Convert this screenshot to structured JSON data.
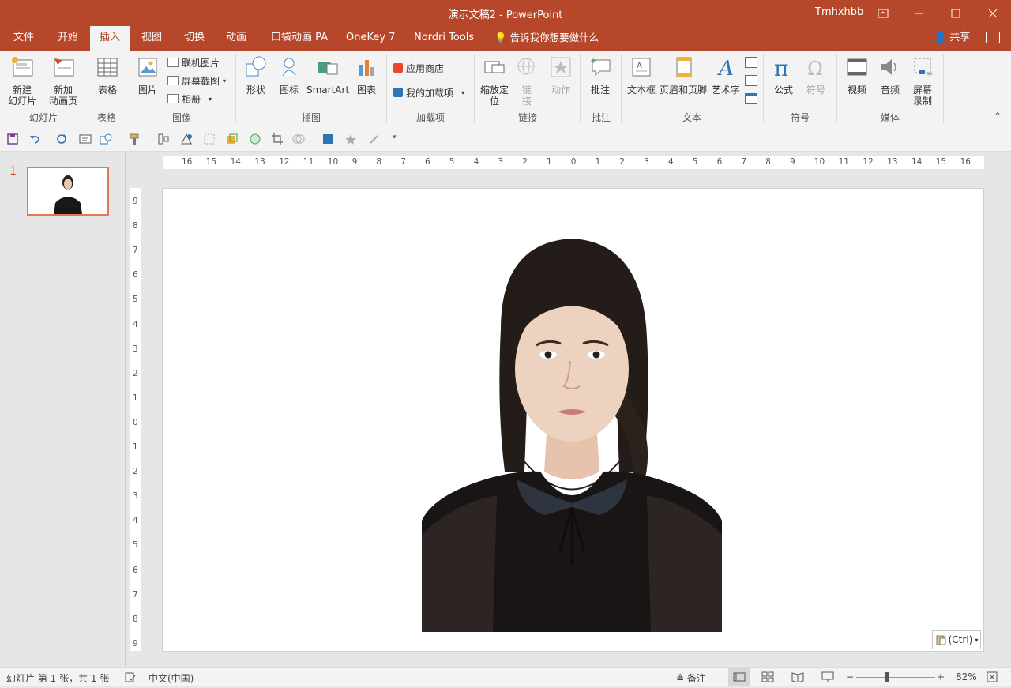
{
  "titlebar": {
    "doc_title": "演示文稿2  -  PowerPoint",
    "user": "Tmhxhbb"
  },
  "menu": {
    "tabs": [
      "文件",
      "开始",
      "插入",
      "视图",
      "切换",
      "动画",
      "口袋动画 PA",
      "OneKey 7",
      "Nordri Tools"
    ],
    "active_tab": "插入",
    "tell_me": "告诉我你想要做什么",
    "share": "共享"
  },
  "ribbon": {
    "slides": {
      "new_slide_l1": "新建",
      "new_slide_l2": "幻灯片",
      "new_anim_l1": "新加",
      "new_anim_l2": "动画页",
      "group": "幻灯片"
    },
    "table": {
      "label": "表格",
      "group": "表格"
    },
    "images": {
      "picture": "图片",
      "online": "联机图片",
      "screenshot": "屏幕截图",
      "album": "相册",
      "group": "图像"
    },
    "illustrations": {
      "shapes": "形状",
      "icons": "图标",
      "smartart": "SmartArt",
      "chart": "图表",
      "group": "插图"
    },
    "addins": {
      "store": "应用商店",
      "my_addins": "我的加载项",
      "group": "加载项"
    },
    "links": {
      "zoom_l1": "缩放定",
      "zoom_l2": "位",
      "link_l1": "链",
      "link_l2": "接",
      "action": "动作",
      "group": "链接"
    },
    "comments": {
      "comment": "批注",
      "group": "批注"
    },
    "text": {
      "textbox": "文本框",
      "header_footer": "页眉和页脚",
      "wordart": "艺术字",
      "group": "文本"
    },
    "symbols": {
      "equation": "公式",
      "symbol": "符号",
      "group": "符号"
    },
    "media": {
      "video": "视频",
      "audio": "音频",
      "rec_l1": "屏幕",
      "rec_l2": "录制",
      "group": "媒体"
    }
  },
  "thumbs": {
    "slide_number": "1"
  },
  "ruler": {
    "h_ticks": [
      "16",
      "15",
      "14",
      "13",
      "12",
      "11",
      "10",
      "9",
      "8",
      "7",
      "6",
      "5",
      "4",
      "3",
      "2",
      "1",
      "0",
      "1",
      "2",
      "3",
      "4",
      "5",
      "6",
      "7",
      "8",
      "9",
      "10",
      "11",
      "12",
      "13",
      "14",
      "15",
      "16"
    ],
    "v_ticks": [
      "9",
      "8",
      "7",
      "6",
      "5",
      "4",
      "3",
      "2",
      "1",
      "0",
      "1",
      "2",
      "3",
      "4",
      "5",
      "6",
      "7",
      "8",
      "9"
    ]
  },
  "paste_options": {
    "label": "(Ctrl)"
  },
  "status": {
    "slide_info": "幻灯片 第 1 张，共 1 张",
    "language": "中文(中国)",
    "notes": "备注",
    "zoom": "82%"
  },
  "colors": {
    "accent": "#b7472a",
    "thumb_border": "#e07a55"
  }
}
